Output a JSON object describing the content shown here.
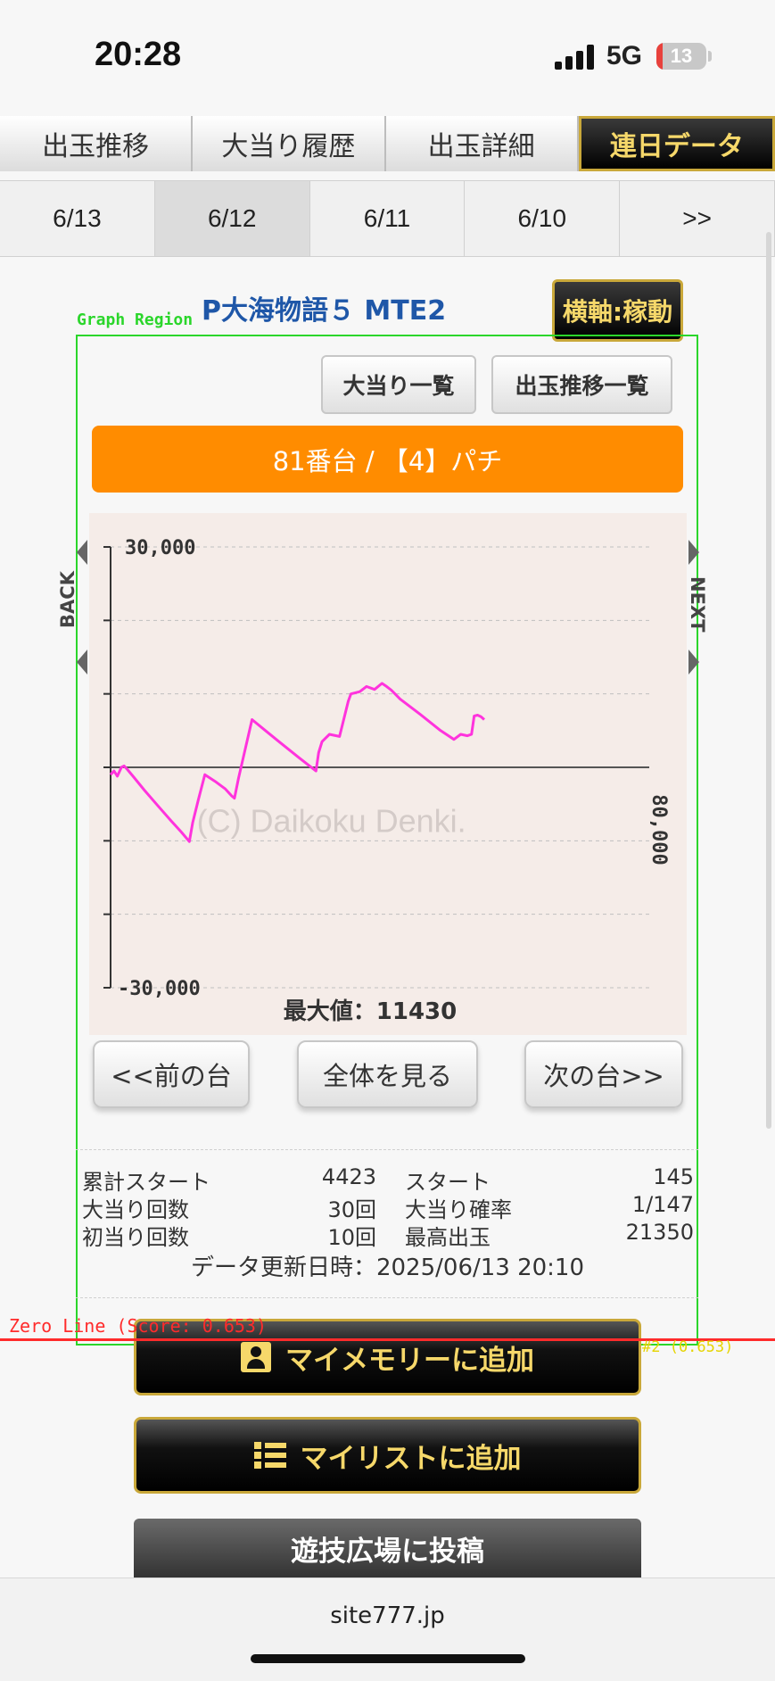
{
  "status": {
    "time": "20:28",
    "network": "5G",
    "battery": "13",
    "battery_level": 0.13
  },
  "top_tabs": [
    {
      "label": "出玉推移",
      "active": false
    },
    {
      "label": "大当り履歴",
      "active": false
    },
    {
      "label": "出玉詳細",
      "active": false
    },
    {
      "label": "連日データ",
      "active": true
    }
  ],
  "date_tabs": [
    {
      "label": "6/13",
      "active": false
    },
    {
      "label": "6/12",
      "active": true
    },
    {
      "label": "6/11",
      "active": false
    },
    {
      "label": "6/10",
      "active": false
    },
    {
      "label": ">>",
      "active": false
    }
  ],
  "machine": {
    "name": "P大海物語５ MTE2",
    "axis_toggle": "横軸:稼動",
    "unit": "81番台 / 【4】パチ"
  },
  "overlay": {
    "graph_region_label": "Graph Region",
    "zero_line_label": "Zero Line (Score: 0.653)",
    "zero_line_note": "#2 (0.653)"
  },
  "buttons": {
    "jackpot_list": "大当り一覧",
    "payout_list": "出玉推移一覧",
    "prev_machine": "<<前の台",
    "view_all": "全体を見る",
    "next_machine": "次の台>>",
    "add_memory": "マイメモリーに追加",
    "add_list": "マイリストに追加",
    "post_plaza": "遊技広場に投稿"
  },
  "nav": {
    "back": "BACK",
    "next": "NEXT"
  },
  "chart_data": {
    "type": "line",
    "y_top_label": "30,000",
    "y_bottom_label": "-30,000",
    "x_end_label": "80,000",
    "ylim": [
      -30000,
      30000
    ],
    "xlim": [
      0,
      80000
    ],
    "max_label": "最大値：11430",
    "watermark": "(C) Daikoku Denki.",
    "line_color": "#ff33dd",
    "x": [
      0,
      500,
      1000,
      1600,
      2000,
      2500,
      3500,
      5000,
      7000,
      9000,
      10500,
      11700,
      12200,
      13000,
      14000,
      15500,
      17000,
      18000,
      18400,
      19000,
      20000,
      21000,
      23000,
      25000,
      28000,
      30500,
      30900,
      31400,
      32500,
      34000,
      35300,
      35700,
      37000,
      38000,
      39200,
      40300,
      41000,
      41700,
      43000,
      46000,
      49000,
      51000,
      52000,
      53000,
      53600,
      54000,
      54500,
      55000,
      55500
    ],
    "y": [
      -1000,
      -500,
      -1200,
      0,
      200,
      -300,
      -1400,
      -3100,
      -5200,
      -7300,
      -8800,
      -10100,
      -7500,
      -4500,
      -1000,
      -1900,
      -2900,
      -3900,
      -4200,
      -1500,
      2500,
      6500,
      5000,
      3500,
      1300,
      -500,
      2000,
      3500,
      4500,
      4200,
      9000,
      10000,
      10300,
      11000,
      10600,
      11430,
      11000,
      10500,
      9300,
      7200,
      5000,
      3800,
      4500,
      4300,
      4500,
      7000,
      7100,
      6900,
      6500
    ]
  },
  "stats": {
    "rows": [
      {
        "l1": "累計スタート",
        "v1": "4423",
        "l2": "スタート",
        "v2": "145"
      },
      {
        "l1": "大当り回数",
        "v1": "30回",
        "l2": "大当り確率",
        "v2": "1/147"
      },
      {
        "l1": "初当り回数",
        "v1": "10回",
        "l2": "最高出玉",
        "v2": "21350"
      }
    ],
    "updated": "データ更新日時：2025/06/13 20:10"
  },
  "browser": {
    "url": "site777.jp"
  }
}
